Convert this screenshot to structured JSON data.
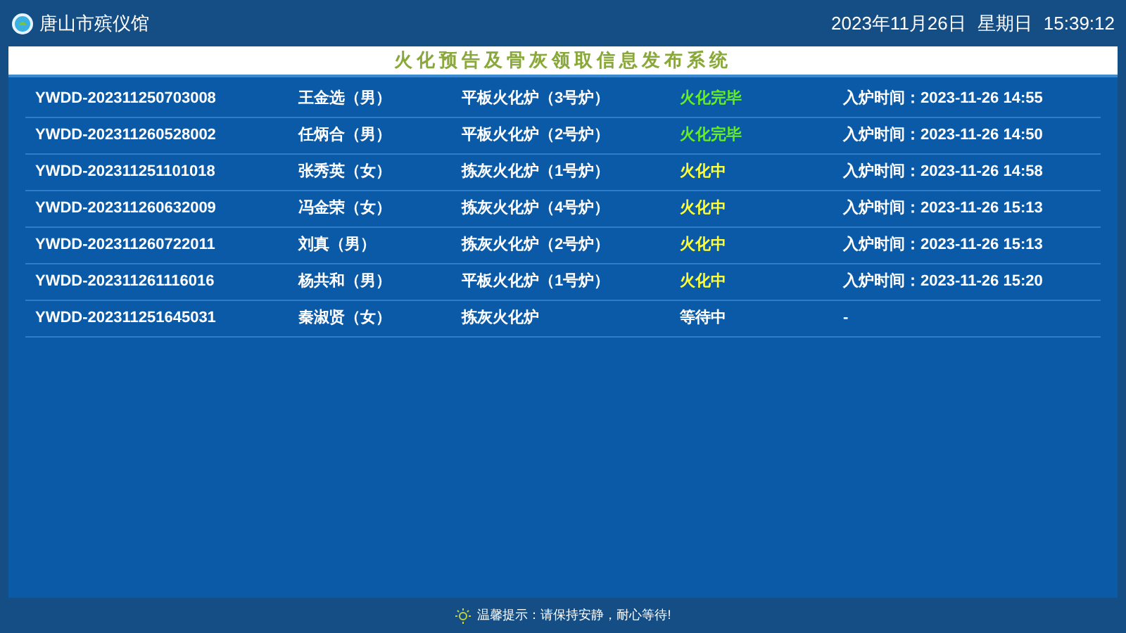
{
  "header": {
    "title": "唐山市殡仪馆",
    "date": "2023年11月26日",
    "weekday": "星期日",
    "time": "15:39:12"
  },
  "banner": {
    "title": "火化预告及骨灰领取信息发布系统"
  },
  "rows": [
    {
      "code": "YWDD-202311250703008",
      "name": "王金选（男）",
      "furnace": "平板火化炉（3号炉）",
      "status": "火化完毕",
      "kind": "done",
      "entry": "入炉时间：2023-11-26 14:55"
    },
    {
      "code": "YWDD-202311260528002",
      "name": "任炳合（男）",
      "furnace": "平板火化炉（2号炉）",
      "status": "火化完毕",
      "kind": "done",
      "entry": "入炉时间：2023-11-26 14:50"
    },
    {
      "code": "YWDD-202311251101018",
      "name": "张秀英（女）",
      "furnace": "拣灰火化炉（1号炉）",
      "status": "火化中",
      "kind": "burning",
      "entry": "入炉时间：2023-11-26 14:58"
    },
    {
      "code": "YWDD-202311260632009",
      "name": "冯金荣（女）",
      "furnace": "拣灰火化炉（4号炉）",
      "status": "火化中",
      "kind": "burning",
      "entry": "入炉时间：2023-11-26 15:13"
    },
    {
      "code": "YWDD-202311260722011",
      "name": "刘真（男）",
      "furnace": "拣灰火化炉（2号炉）",
      "status": "火化中",
      "kind": "burning",
      "entry": "入炉时间：2023-11-26 15:13"
    },
    {
      "code": "YWDD-202311261116016",
      "name": "杨共和（男）",
      "furnace": "平板火化炉（1号炉）",
      "status": "火化中",
      "kind": "burning",
      "entry": "入炉时间：2023-11-26 15:20"
    },
    {
      "code": "YWDD-202311251645031",
      "name": "秦淑贤（女）",
      "furnace": "拣灰火化炉",
      "status": "等待中",
      "kind": "waiting",
      "entry": "-"
    }
  ],
  "footer": {
    "notice": "温馨提示：请保持安静，耐心等待!"
  }
}
